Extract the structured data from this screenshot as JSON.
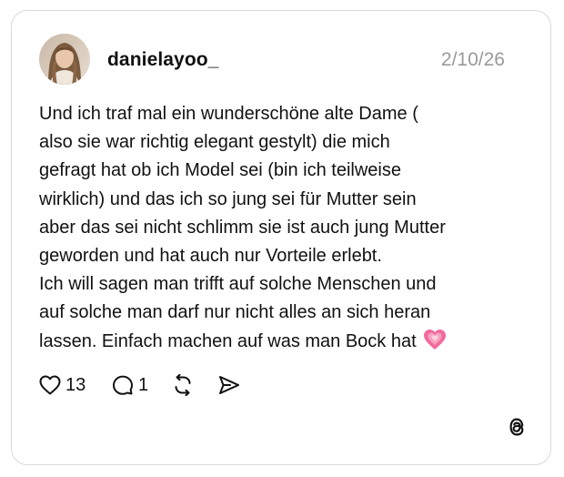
{
  "post": {
    "username": "danielayoo_",
    "date": "2/10/26",
    "lines": [
      "Und ich traf mal ein wunderschöne alte Dame (",
      "also sie war richtig elegant gestylt) die mich",
      "gefragt hat ob ich Model sei (bin ich teilweise",
      "wirklich) und das ich so jung sei für Mutter sein",
      "aber das sei nicht schlimm sie ist auch jung Mutter",
      "geworden und hat auch nur Vorteile erlebt.",
      "Ich will sagen man trifft auf solche Menschen und",
      "auf solche man darf nur nicht alles an sich heran",
      "lassen. Einfach machen auf was man Bock hat"
    ],
    "trailing_emoji": "growing-heart-emoji"
  },
  "actions": {
    "like_count": "13",
    "reply_count": "1",
    "like_icon": "heart-outline-icon",
    "reply_icon": "speech-bubble-icon",
    "repost_icon": "repost-icon",
    "share_icon": "send-icon"
  },
  "branding": {
    "logo": "threads-logo"
  },
  "colors": {
    "text": "#111111",
    "muted": "#9a9a9a",
    "border": "#d9d9d9",
    "emoji_pink": "#f06a9a"
  }
}
